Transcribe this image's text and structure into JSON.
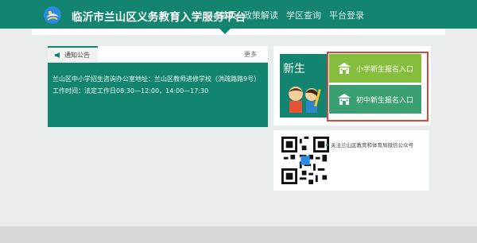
{
  "header": {
    "site_title": "临沂市兰山区义务教育入学服务平台",
    "nav": [
      {
        "label": "首页",
        "active": true
      },
      {
        "label": "政策解读",
        "active": false
      },
      {
        "label": "学区查询",
        "active": false
      },
      {
        "label": "平台登录",
        "active": false
      }
    ]
  },
  "notice": {
    "tab_label": "通知公告",
    "more_label": "更多",
    "lines": [
      "兰山区中小学招生咨询办公室地址：兰山区教师进修学校（洪疏路路9号）",
      "工作时间：法定工作日08:30—12:00，14:00—17:30"
    ]
  },
  "enroll": {
    "banner_title": "新生",
    "primary_label": "小学新生报名入口",
    "middle_label": "初中新生报名入口"
  },
  "qr": {
    "text": "关注兰山区教育和体育局微信公众号"
  },
  "colors": {
    "primary_green": "#12846f",
    "light_green": "#86bd3c",
    "button_green": "#3a9f71",
    "highlight_red": "#d24a3b"
  }
}
